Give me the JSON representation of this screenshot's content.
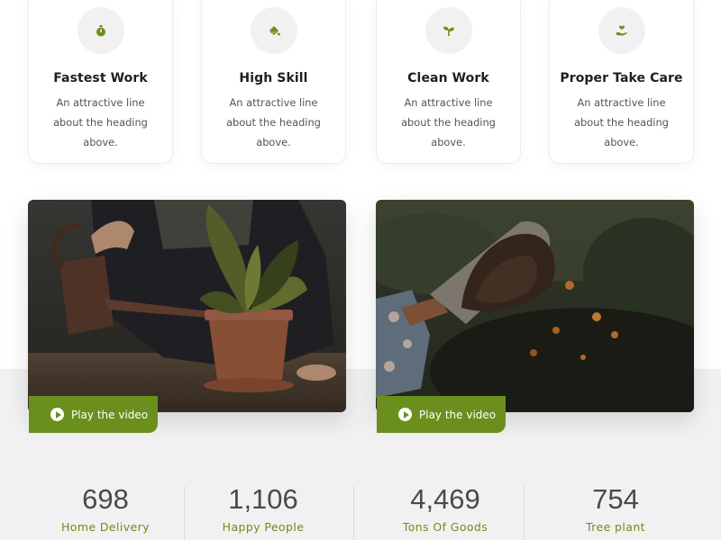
{
  "colors": {
    "accent": "#6a8f1c",
    "icon_bg": "#f1f1f1",
    "section_bg": "#f1f1f1"
  },
  "features": [
    {
      "title": "Fastest Work",
      "description": "An attractive line about the heading above.",
      "icon": "stopwatch-icon"
    },
    {
      "title": "High Skill",
      "description": "An attractive line about the heading above.",
      "icon": "paint-bucket-icon"
    },
    {
      "title": "Clean Work",
      "description": "An attractive line about the heading above.",
      "icon": "sprout-icon"
    },
    {
      "title": "Proper Take Care",
      "description": "An attractive line about the heading above.",
      "icon": "hand-heart-icon"
    }
  ],
  "videos": [
    {
      "label": "Play the video",
      "scene": "watering-plant-photo"
    },
    {
      "label": "Play the video",
      "scene": "garden-trowel-soil-photo"
    }
  ],
  "stats": [
    {
      "number": "698",
      "label": "Home Delivery"
    },
    {
      "number": "1,106",
      "label": "Happy People"
    },
    {
      "number": "4,469",
      "label": "Tons Of Goods"
    },
    {
      "number": "754",
      "label": "Tree plant"
    }
  ]
}
